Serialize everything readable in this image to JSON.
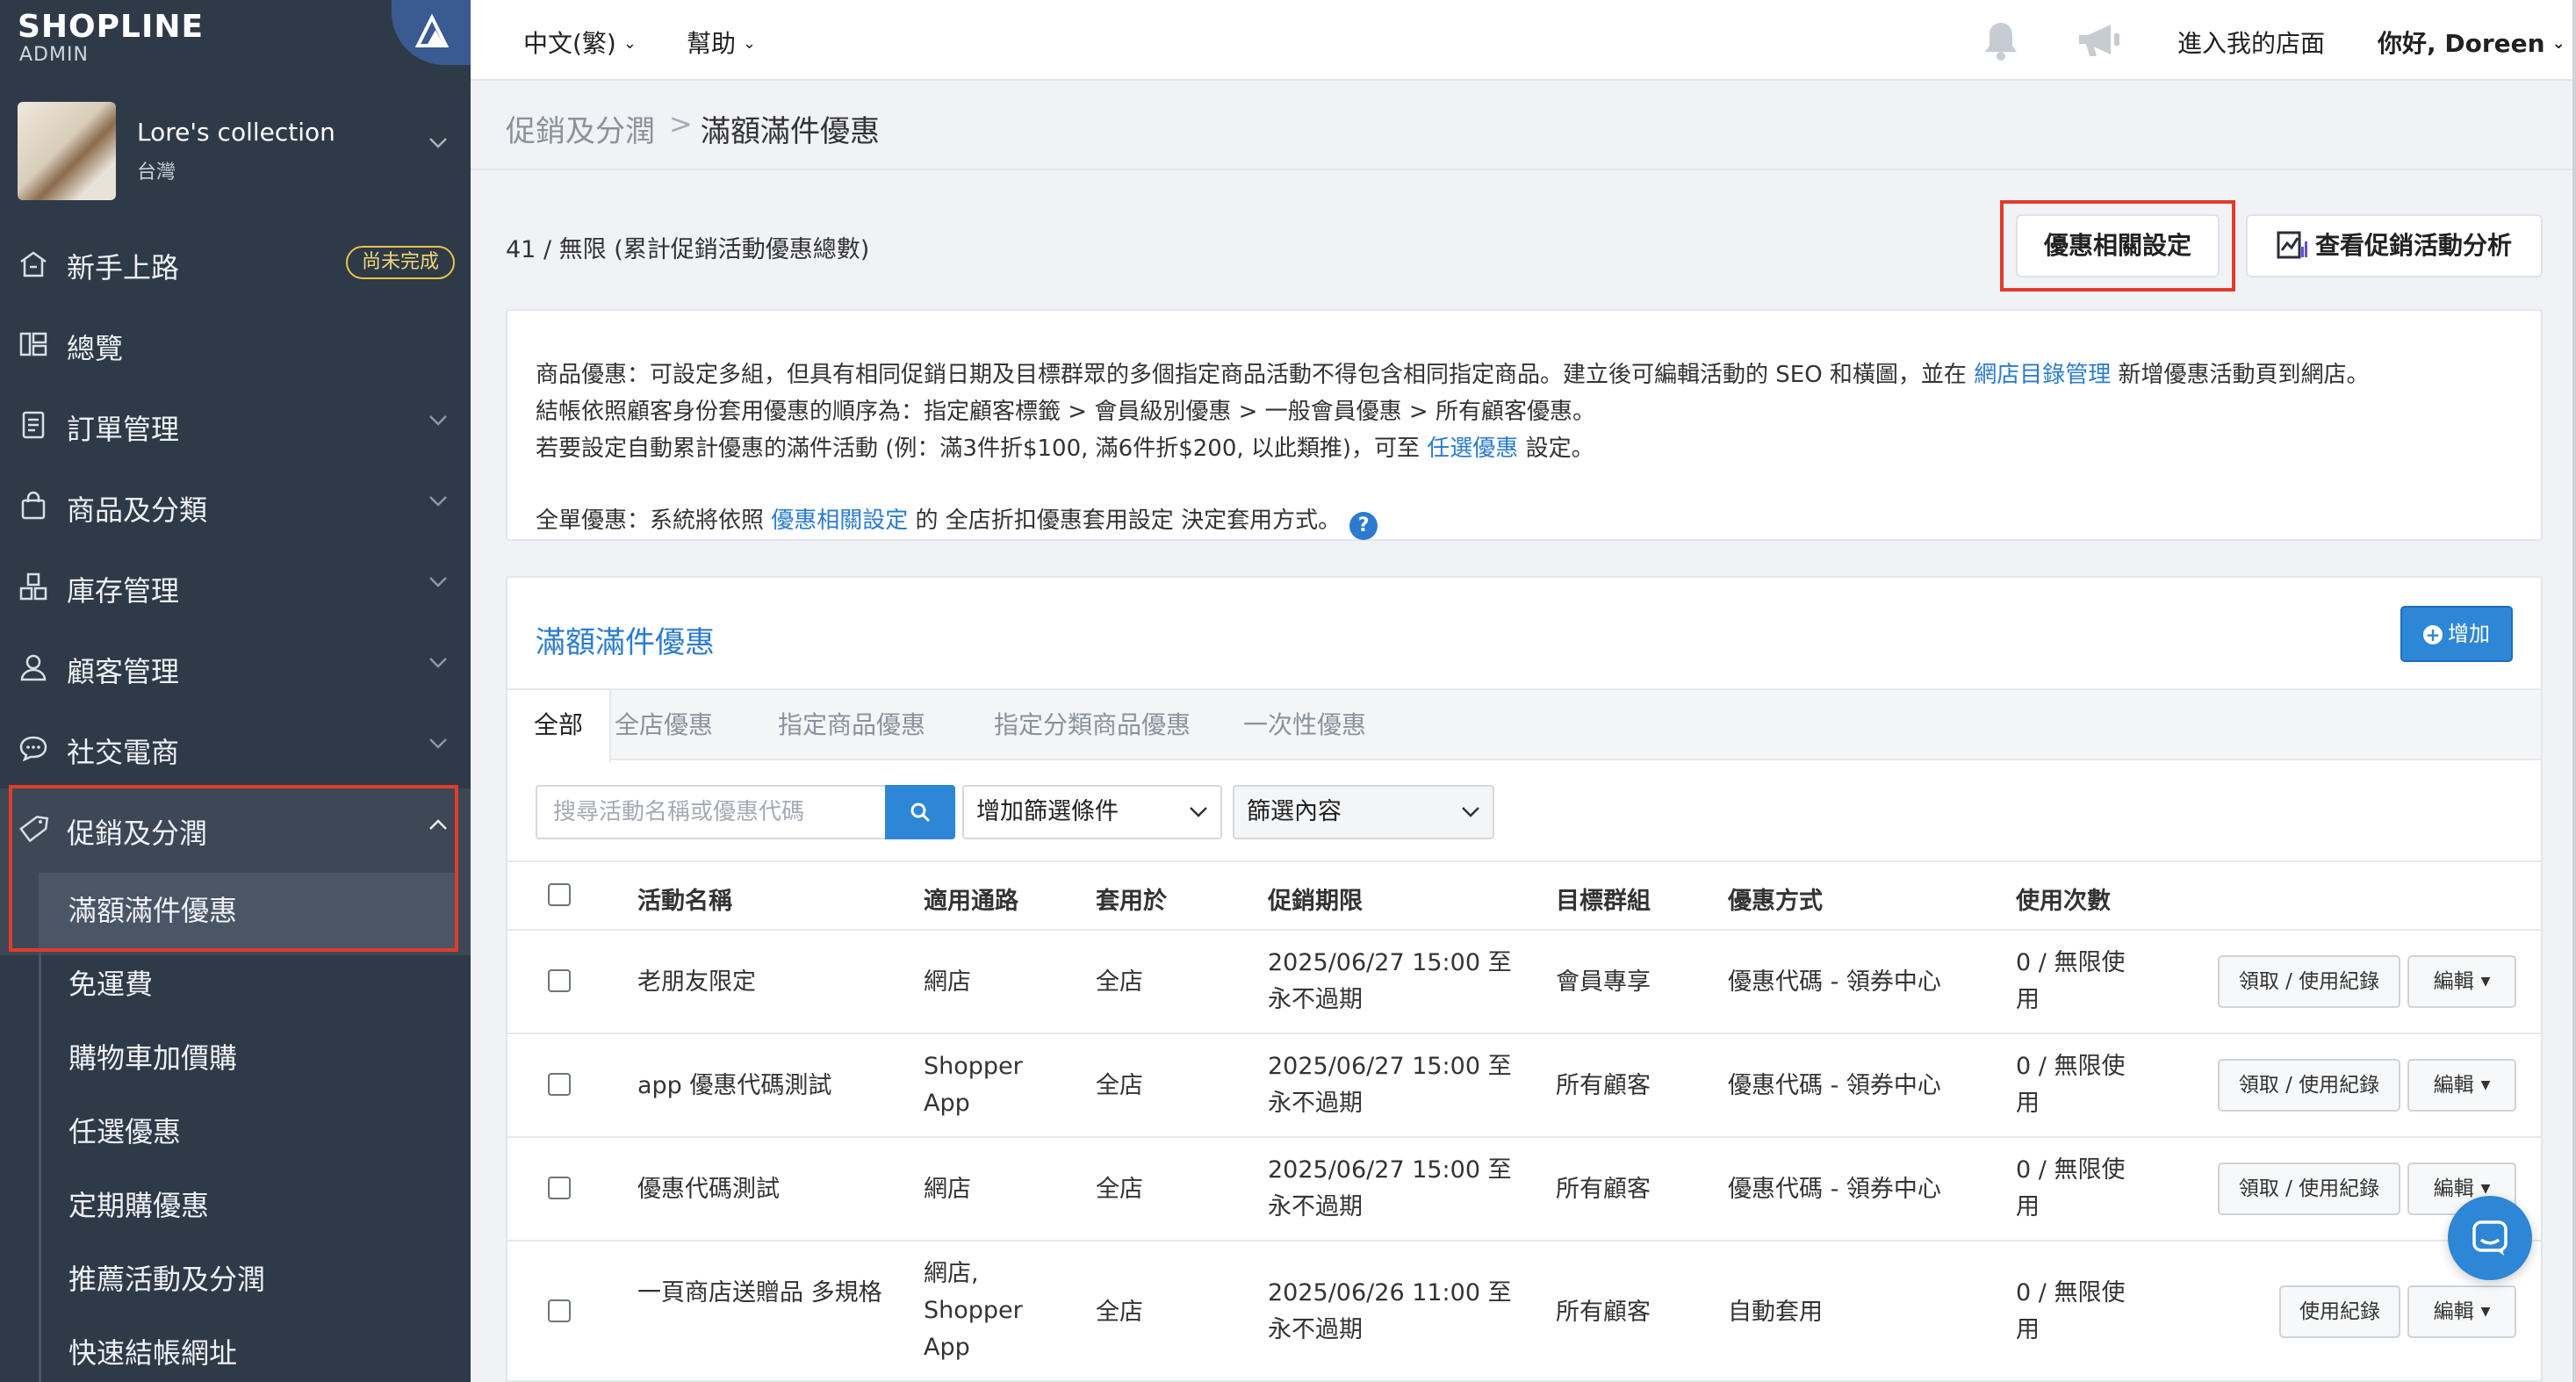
{
  "brand": {
    "logo": "SHOPLINE",
    "sub": "ADMIN"
  },
  "store": {
    "name": "Lore's collection",
    "region": "台灣"
  },
  "sidebar": {
    "items": [
      {
        "label": "新手上路",
        "badge": "尚未完成"
      },
      {
        "label": "總覽"
      },
      {
        "label": "訂單管理"
      },
      {
        "label": "商品及分類"
      },
      {
        "label": "庫存管理"
      },
      {
        "label": "顧客管理"
      },
      {
        "label": "社交電商"
      },
      {
        "label": "促銷及分潤"
      }
    ],
    "promo_sub": [
      "滿額滿件優惠",
      "免運費",
      "購物車加價購",
      "任選優惠",
      "定期購優惠",
      "推薦活動及分潤",
      "快速結帳網址"
    ]
  },
  "topbar": {
    "language": "中文(繁)",
    "help": "幫助",
    "store_link": "進入我的店面",
    "greeting": "你好, Doreen"
  },
  "breadcrumb": {
    "parent": "促銷及分潤",
    "separator": ">",
    "current": "滿額滿件優惠"
  },
  "usage": "41 / 無限 (累計促銷活動優惠總數)",
  "actions": {
    "settings": "優惠相關設定",
    "analytics": "查看促銷活動分析"
  },
  "info": {
    "line1_a": "商品優惠：可設定多組，但具有相同促銷日期及目標群眾的多個指定商品活動不得包含相同指定商品。建立後可編輯活動的 SEO 和橫圖，並在 ",
    "line1_link": "網店目錄管理",
    "line1_b": " 新增優惠活動頁到網店。",
    "line2": "結帳依照顧客身份套用優惠的順序為：指定顧客標籤 > 會員級別優惠 > 一般會員優惠 > 所有顧客優惠。",
    "line3_a": "若要設定自動累計優惠的滿件活動 (例：滿3件折$100, 滿6件折$200, 以此類推)，可至 ",
    "line3_link": "任選優惠",
    "line3_b": " 設定。",
    "line4_a": "全單優惠：系統將依照 ",
    "line4_link": "優惠相關設定",
    "line4_b": " 的 全店折扣優惠套用設定 決定套用方式。",
    "help_glyph": "?"
  },
  "list": {
    "title": "滿額滿件優惠",
    "add_label": "增加",
    "tabs": [
      "全部",
      "全店優惠",
      "指定商品優惠",
      "指定分類商品優惠",
      "一次性優惠"
    ],
    "search_placeholder": "搜尋活動名稱或優惠代碼",
    "filter_label": "增加篩選條件",
    "filter_content_label": "篩選內容",
    "columns": [
      "活動名稱",
      "適用通路",
      "套用於",
      "促銷期限",
      "目標群組",
      "優惠方式",
      "使用次數"
    ],
    "rows": [
      {
        "name": "老朋友限定",
        "channel": "網店",
        "apply": "全店",
        "period1": "2025/06/27 15:00 至",
        "period2": "永不過期",
        "target": "會員專享",
        "method": "優惠代碼 - 領券中心",
        "usage1": "0 / 無限使",
        "usage2": "用",
        "record": "領取 / 使用紀錄",
        "edit": "編輯"
      },
      {
        "name": "app 優惠代碼測試",
        "channel": "Shopper App",
        "apply": "全店",
        "period1": "2025/06/27 15:00 至",
        "period2": "永不過期",
        "target": "所有顧客",
        "method": "優惠代碼 - 領券中心",
        "usage1": "0 / 無限使",
        "usage2": "用",
        "record": "領取 / 使用紀錄",
        "edit": "編輯"
      },
      {
        "name": "優惠代碼測試",
        "channel": "網店",
        "apply": "全店",
        "period1": "2025/06/27 15:00 至",
        "period2": "永不過期",
        "target": "所有顧客",
        "method": "優惠代碼 - 領券中心",
        "usage1": "0 / 無限使",
        "usage2": "用",
        "record": "領取 / 使用紀錄",
        "edit": "編輯"
      },
      {
        "name": "一頁商店送贈品 多規格",
        "channel": "網店, Shopper App",
        "apply": "全店",
        "period1": "2025/06/26 11:00 至",
        "period2": "永不過期",
        "target": "所有顧客",
        "method": "自動套用",
        "usage1": "0 / 無限使",
        "usage2": "用",
        "record": "使用紀錄",
        "edit": "編輯"
      }
    ]
  },
  "colors": {
    "sidebar_bg": "#2f3a48",
    "accent": "#2e86d6",
    "link": "#2b7bd0",
    "highlight_outline": "#e03c2c",
    "badge": "#e8c34a"
  },
  "icons": [
    "home-icon",
    "dashboard-icon",
    "order-icon",
    "bag-icon",
    "inventory-icon",
    "user-icon",
    "chat-icon",
    "tag-icon",
    "bell-icon",
    "megaphone-icon",
    "chart-icon",
    "search-icon",
    "chevron-down-icon",
    "messenger-icon"
  ]
}
